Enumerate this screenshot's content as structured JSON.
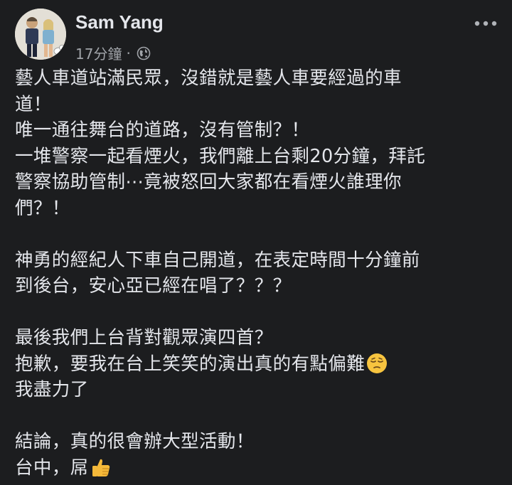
{
  "post": {
    "author": "Sam Yang",
    "timestamp": "17分鐘",
    "separator": "·",
    "privacy_icon": "globe-icon",
    "more_icon": "more-options-icon",
    "paragraphs": [
      {
        "lines": [
          "藝人車道站滿民眾，沒錯就是藝人車要經過的車",
          "道！",
          "唯一通往舞台的道路，沒有管制？！",
          "一堆警察一起看煙火，我們離上台剩20分鐘，拜託",
          "警察協助管制⋯竟被怒回大家都在看煙火誰理你",
          "們？！"
        ]
      },
      {
        "lines": [
          "神勇的經紀人下車自己開道，在表定時間十分鐘前",
          "到後台，安心亞已經在唱了？？？"
        ]
      },
      {
        "lines": [
          "最後我們上台背對觀眾演四首？",
          "抱歉，要我在台上笑笑的演出真的有點偏難",
          "我盡力了"
        ],
        "emoji_line": 1,
        "emoji": "pensive-face-emoji"
      },
      {
        "lines": [
          "結論，真的很會辦大型活動！",
          "台中，屌"
        ],
        "emoji_line": 1,
        "emoji": "thumbs-up-emoji"
      }
    ]
  }
}
